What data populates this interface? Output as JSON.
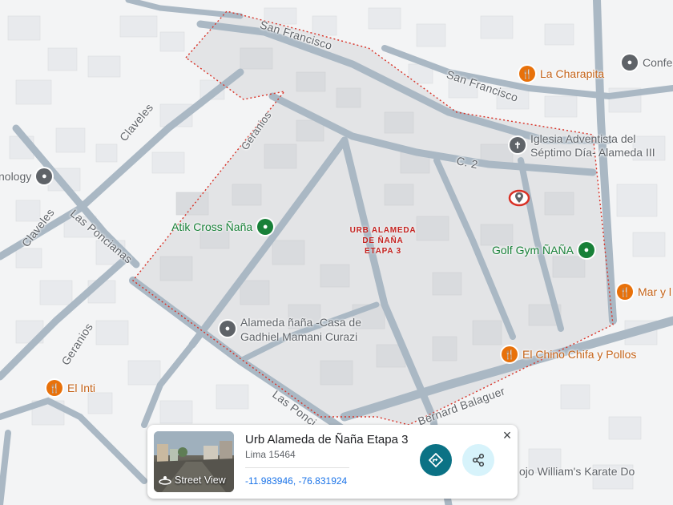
{
  "streets": {
    "san_francisco_1": "San Francisco",
    "san_francisco_2": "San Francisco",
    "claveles_1": "Claveles",
    "claveles_2": "Claveles",
    "geranios_1": "Geranios",
    "geranios_2": "Geranios",
    "las_poncianas_1": "Las Poncianas",
    "las_poncianas_2": "Las Ponci...",
    "c2": "C. 2",
    "bernard": "Bernard Balaguer"
  },
  "area_label": [
    "URB ALAMEDA",
    "DE ÑAÑA",
    "ETAPA 3"
  ],
  "pois": {
    "la_charapita": "La Charapita",
    "iglesia": [
      "Iglesia Adventista del",
      "Séptimo Día- Alameda III"
    ],
    "atik": "Atik Cross Ñaña",
    "golf_gym": "Golf Gym ÑAÑA",
    "alameda_casa": [
      "Alameda ñaña -Casa de",
      "Gadhiel Mamani Curazi"
    ],
    "el_chino": "El Chino Chifa y Pollos",
    "el_inti": "El Inti",
    "mar_y": "Mar y l",
    "confe": "Confe",
    "nology": "nology",
    "karate": "ojo William's Karate Do"
  },
  "card": {
    "title": "Urb Alameda de Ñaña Etapa 3",
    "subtitle": "Lima 15464",
    "coords": "-11.983946, -76.831924",
    "street_view": "Street View",
    "close": "×"
  },
  "colors": {
    "area_fill": "#e3e4e6",
    "boundary": "#d93025",
    "road": "#aab8c4",
    "poi_green": "#188038",
    "poi_orange": "#e8710a",
    "poi_gray": "#5f6368",
    "directions": "#0b7285"
  },
  "icons": {
    "directions": "directions-icon",
    "share": "share-icon",
    "street_view": "street-view-icon",
    "close": "close-icon"
  }
}
